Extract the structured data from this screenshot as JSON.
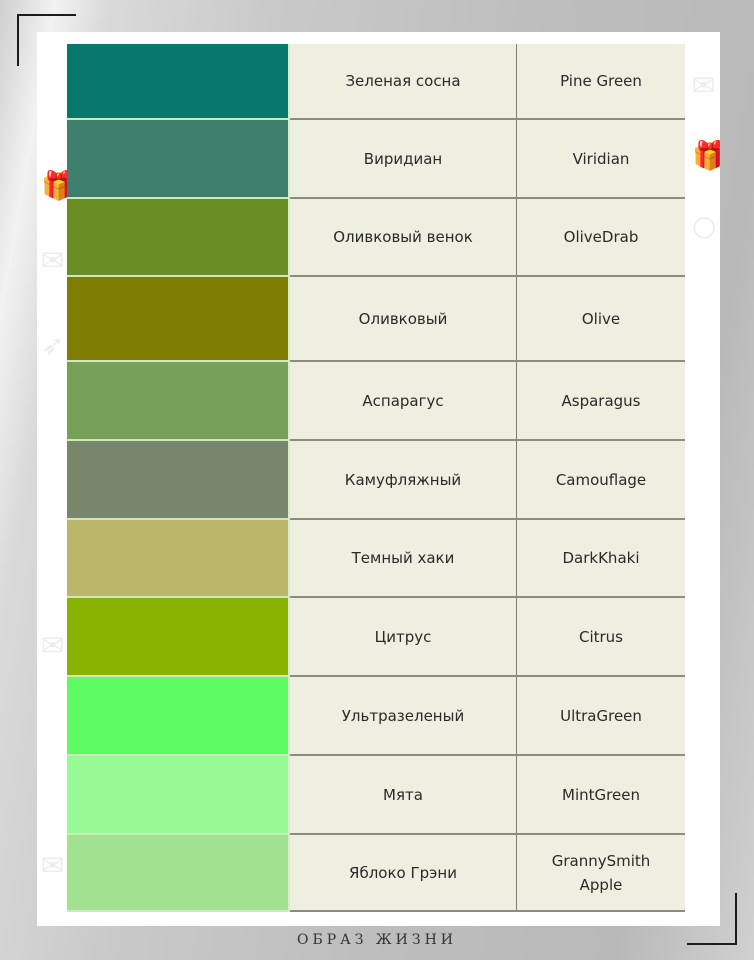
{
  "footer_caption": "ОБРАЗ ЖИЗНИ",
  "colors": [
    {
      "ru": "Зеленая сосна",
      "en": "Pine Green",
      "hex": "#07786b"
    },
    {
      "ru": "Виридиан",
      "en": "Viridian",
      "hex": "#3e806c"
    },
    {
      "ru": "Оливковый венок",
      "en": "OliveDrab",
      "hex": "#6a8e23"
    },
    {
      "ru": "Оливковый",
      "en": "Olive",
      "hex": "#7f7e00"
    },
    {
      "ru": "Аспарагус",
      "en": "Asparagus",
      "hex": "#77a159"
    },
    {
      "ru": "Камуфляжный",
      "en": "Camouflage",
      "hex": "#78876b"
    },
    {
      "ru": "Темный хаки",
      "en": "DarkKhaki",
      "hex": "#bcb66a"
    },
    {
      "ru": "Цитрус",
      "en": "Citrus",
      "hex": "#8ab201"
    },
    {
      "ru": "Ультразеленый",
      "en": "UltraGreen",
      "hex": "#5efa62"
    },
    {
      "ru": "Мята",
      "en": "MintGreen",
      "hex": "#98fa95"
    },
    {
      "ru": "Яблоко Грэни",
      "en": "GrannySmith Apple",
      "hex": "#a0e290"
    }
  ]
}
